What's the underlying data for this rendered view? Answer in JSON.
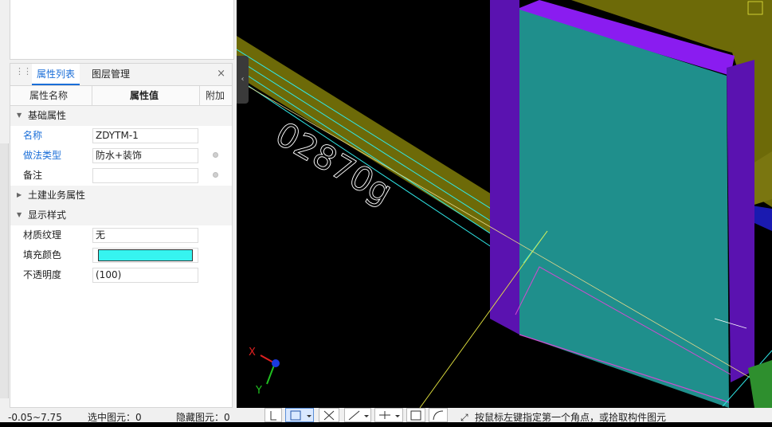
{
  "panel": {
    "tabs": {
      "properties": "属性列表",
      "layers": "图层管理"
    },
    "close_glyph": "×",
    "columns": {
      "name": "属性名称",
      "value": "属性值",
      "add": "附加"
    },
    "groups": {
      "basic": "基础属性",
      "civil": "土建业务属性",
      "display": "显示样式"
    },
    "props": {
      "name": {
        "label": "名称",
        "value": "ZDYTM-1"
      },
      "method": {
        "label": "做法类型",
        "value": "防水+装饰"
      },
      "remark": {
        "label": "备注",
        "value": ""
      },
      "texture": {
        "label": "材质纹理",
        "value": "无"
      },
      "fill": {
        "label": "填充颜色",
        "color": "#36f4f0"
      },
      "opacity": {
        "label": "不透明度",
        "value": "(100)"
      }
    }
  },
  "viewport": {
    "dimension_label": "02870g",
    "axis_x": "X",
    "axis_y": "Y"
  },
  "status": {
    "elevation": "-0.05~7.75",
    "selected": "选中图元：0",
    "hidden": "隐藏图元：0",
    "hint": "按鼠标左键指定第一个角点，或拾取构件图元"
  }
}
